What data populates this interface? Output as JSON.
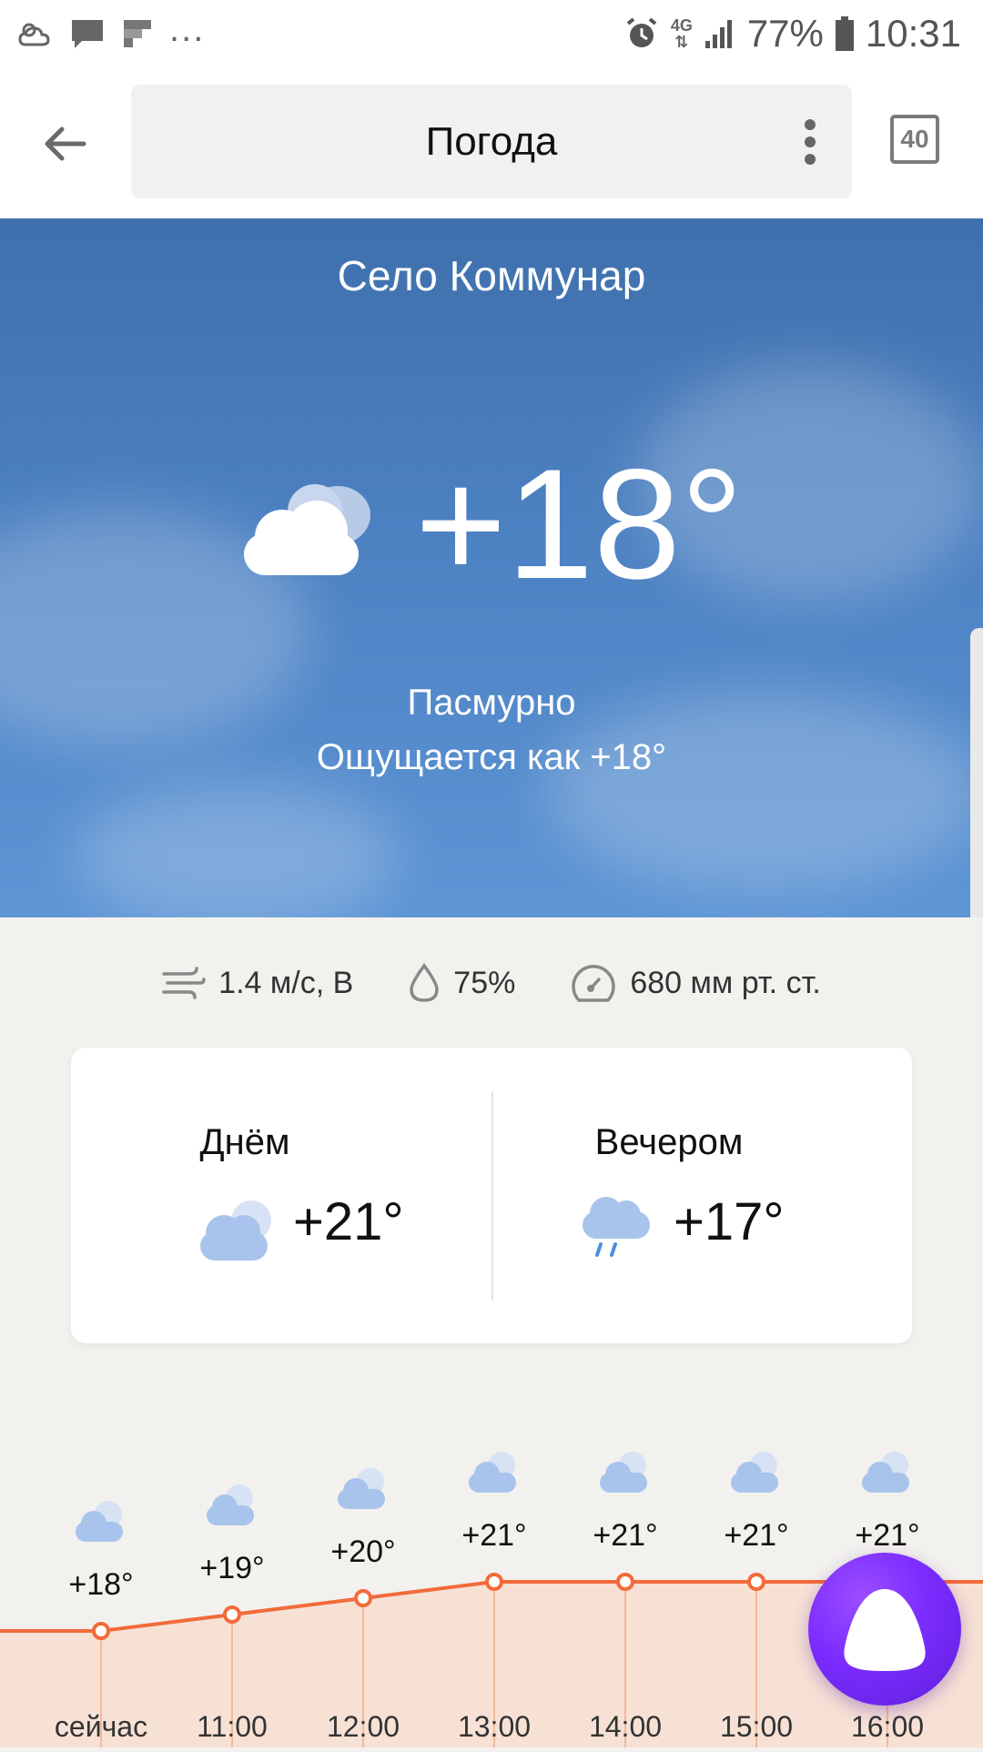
{
  "status_bar": {
    "dots": "...",
    "network": "4G",
    "battery": "77%",
    "time": "10:31",
    "icons": [
      "sun-cloud-icon",
      "chat-icon",
      "flipboard-icon",
      "alarm-icon",
      "signal-icon",
      "battery-icon"
    ]
  },
  "toolbar": {
    "title": "Погода",
    "tabs_count": "40"
  },
  "hero": {
    "city": "Село Коммунар",
    "temp": "+18°",
    "condition": "Пасмурно",
    "feels_like": "Ощущается как +18°",
    "icon": "cloudy-icon"
  },
  "meta": {
    "wind": "1.4 м/с, В",
    "humidity": "75%",
    "pressure": "680 мм рт. ст."
  },
  "dayparts": [
    {
      "label": "Днём",
      "temp": "+21°",
      "icon": "cloudy-icon"
    },
    {
      "label": "Вечером",
      "temp": "+17°",
      "icon": "rain-icon"
    }
  ],
  "chart_data": {
    "type": "line",
    "categories": [
      "сейчас",
      "11:00",
      "12:00",
      "13:00",
      "14:00",
      "15:00",
      "16:00"
    ],
    "labels": [
      "+18°",
      "+19°",
      "+20°",
      "+21°",
      "+21°",
      "+21°",
      "+21°"
    ],
    "values": [
      18,
      19,
      20,
      21,
      21,
      21,
      21
    ],
    "colors": {
      "line": "#f26b3a",
      "fill": "#f7e1d5"
    }
  }
}
